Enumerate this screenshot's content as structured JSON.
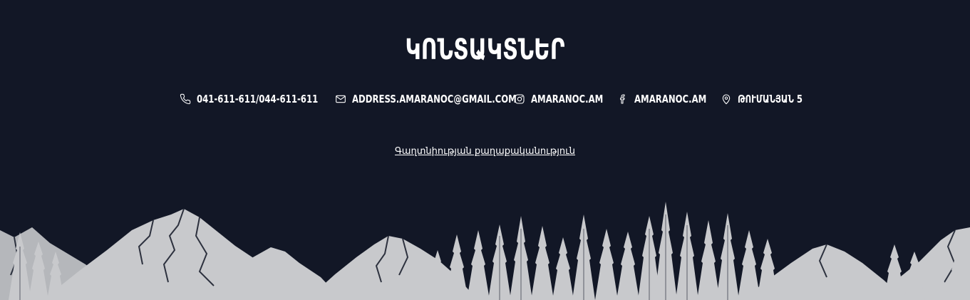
{
  "section": {
    "title": "ԿՈՆՏԱԿՏՆԵՐ"
  },
  "contacts": [
    {
      "id": "phone",
      "icon": "phone-icon",
      "label": "041-611-611/044-611-611"
    },
    {
      "id": "email",
      "icon": "mail-icon",
      "label": "ADDRESS.AMARANOC@GMAIL.COM"
    },
    {
      "id": "instagram",
      "icon": "instagram-icon",
      "label": "AMARANOC.AM"
    },
    {
      "id": "facebook",
      "icon": "facebook-icon",
      "label": "AMARANOC.AM"
    },
    {
      "id": "address",
      "icon": "location-pin-icon",
      "label": "ԹՈՒՄԱՆՅԱՆ 5"
    }
  ],
  "privacy_link": "Գաղտնիության քաղաքականություն",
  "colors": {
    "background": "#121726",
    "text": "#ffffff",
    "illustration": "#c8c9cc"
  }
}
